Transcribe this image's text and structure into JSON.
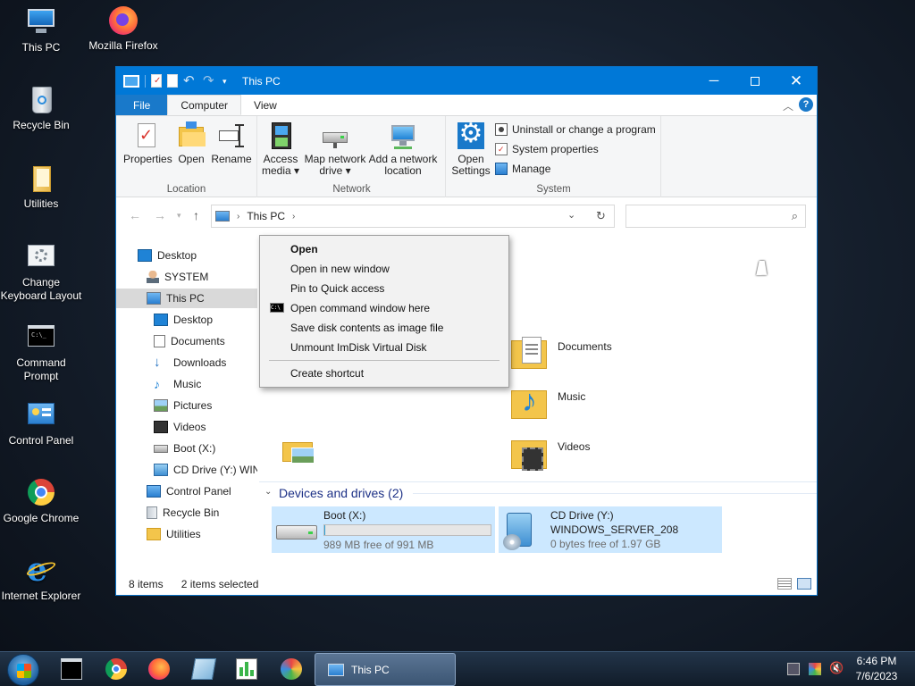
{
  "desktop": {
    "icons": [
      {
        "label": "This PC"
      },
      {
        "label": "Mozilla Firefox"
      },
      {
        "label": "Recycle Bin"
      },
      {
        "label": "Utilities"
      },
      {
        "label": "Change Keyboard Layout"
      },
      {
        "label": "Command Prompt"
      },
      {
        "label": "Control Panel"
      },
      {
        "label": "Google Chrome"
      },
      {
        "label": "Internet Explorer"
      }
    ]
  },
  "window": {
    "title": "This PC",
    "tabs": {
      "file": "File",
      "computer": "Computer",
      "view": "View"
    },
    "ribbon": {
      "location": {
        "name": "Location",
        "properties": "Properties",
        "open": "Open",
        "rename": "Rename"
      },
      "network": {
        "name": "Network",
        "access_media": [
          "Access",
          "media ▾"
        ],
        "map_network_drive": [
          "Map network",
          "drive ▾"
        ],
        "add_network_location": [
          "Add a network",
          "location"
        ]
      },
      "system": {
        "name": "System",
        "open_settings": [
          "Open",
          "Settings"
        ],
        "uninstall": "Uninstall or change a program",
        "system_properties": "System properties",
        "manage": "Manage"
      }
    },
    "address": {
      "path": "This PC",
      "search_placeholder": ""
    },
    "nav": [
      {
        "label": "Desktop"
      },
      {
        "label": "SYSTEM"
      },
      {
        "label": "This PC"
      },
      {
        "label": "Desktop"
      },
      {
        "label": "Documents"
      },
      {
        "label": "Downloads"
      },
      {
        "label": "Music"
      },
      {
        "label": "Pictures"
      },
      {
        "label": "Videos"
      },
      {
        "label": "Boot (X:)"
      },
      {
        "label": "CD Drive (Y:) WINI"
      },
      {
        "label": "Control Panel"
      },
      {
        "label": "Recycle Bin"
      },
      {
        "label": "Utilities"
      }
    ],
    "folders": [
      {
        "label": "Documents"
      },
      {
        "label": "Music"
      },
      {
        "label": "Videos"
      }
    ],
    "devices_header": "Devices and drives (2)",
    "drives": [
      {
        "name": "Boot (X:)",
        "free": "989 MB free of 991 MB",
        "used_fraction": 0.002
      },
      {
        "name": "CD Drive (Y:)",
        "volume": "WINDOWS_SERVER_208",
        "free": "0 bytes free of 1.97 GB"
      }
    ],
    "status": {
      "items": "8 items",
      "selected": "2 items selected"
    }
  },
  "context_menu": {
    "open": "Open",
    "open_new_window": "Open in new window",
    "pin_quick_access": "Pin to Quick access",
    "open_cmd": "Open command window here",
    "save_image": "Save disk contents as image file",
    "unmount": "Unmount ImDisk Virtual Disk",
    "create_shortcut": "Create shortcut"
  },
  "taskbar": {
    "active_label": "This PC",
    "time": "6:46 PM",
    "date": "7/6/2023"
  },
  "colors": {
    "accent": "#0078d7",
    "selection": "#cce8ff",
    "file_tab": "#1979ca"
  }
}
